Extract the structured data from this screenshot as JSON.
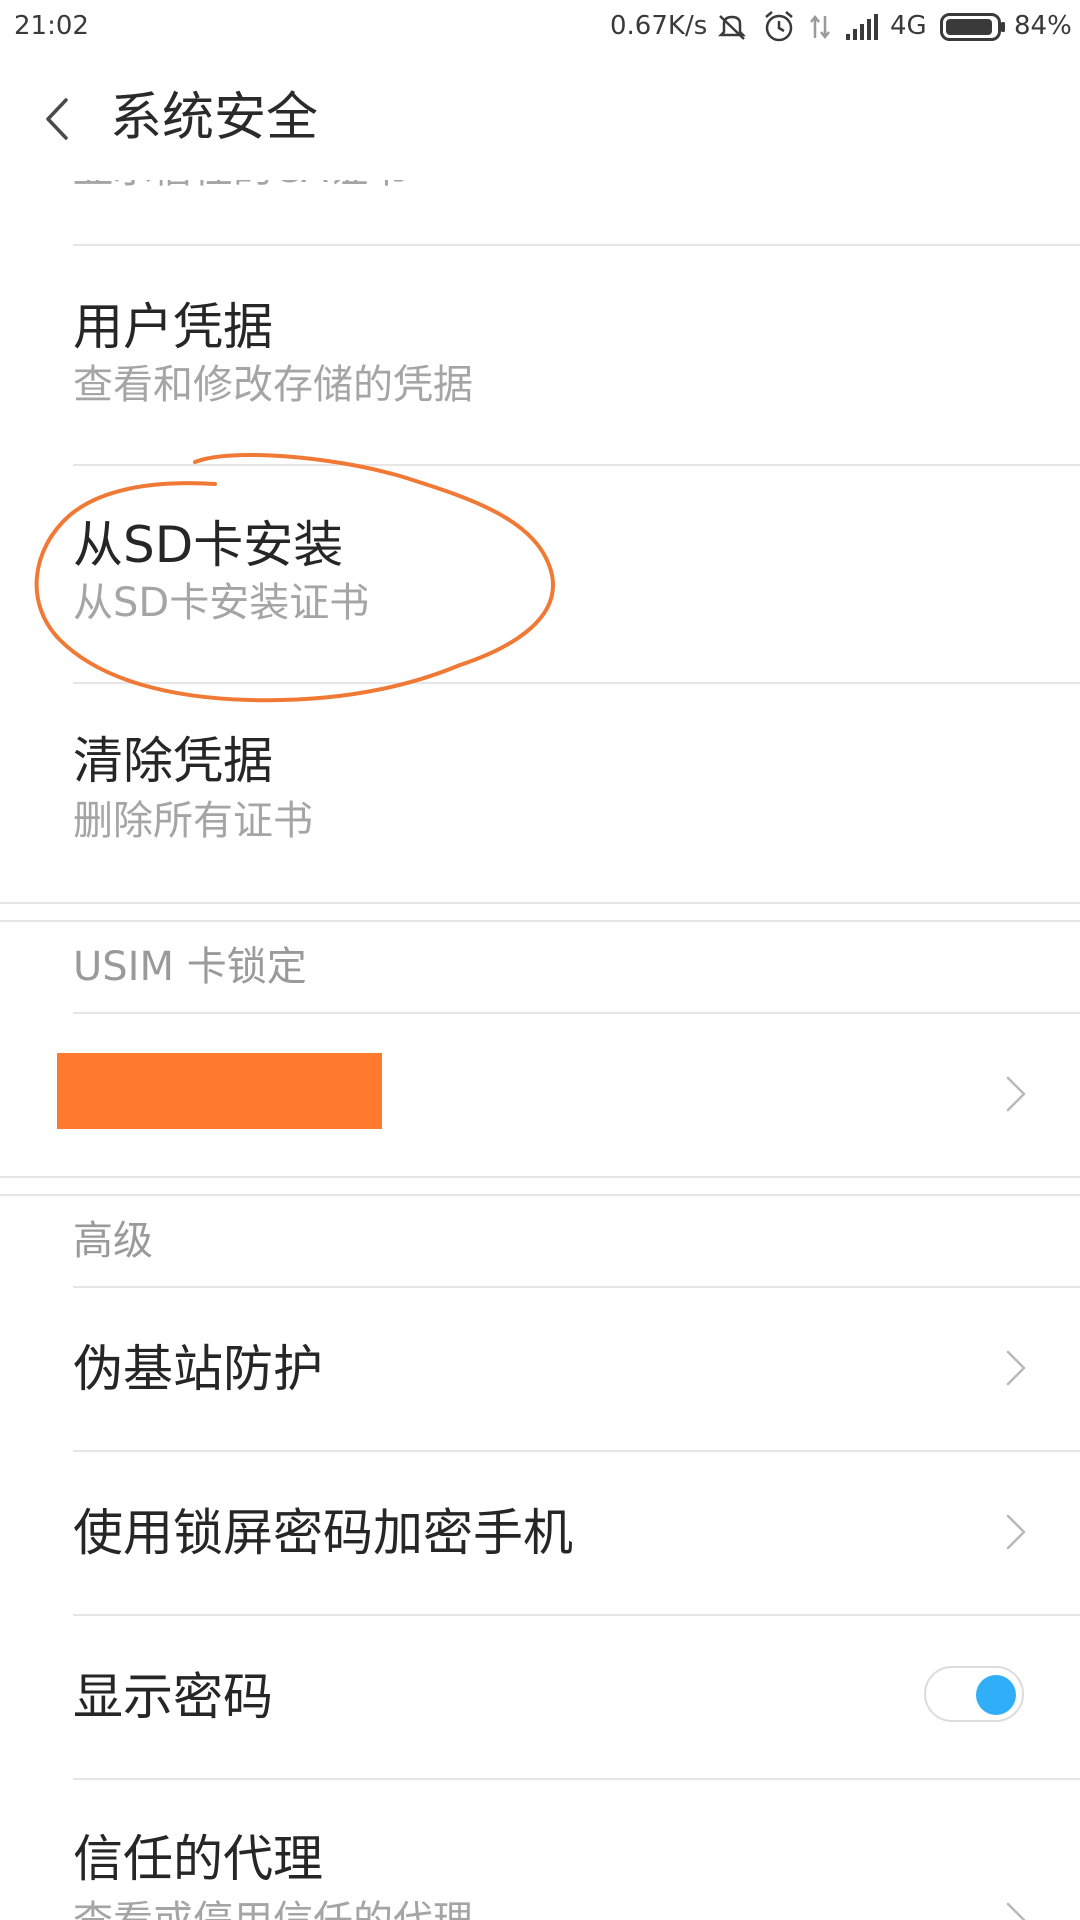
{
  "status_bar": {
    "time": "21:02",
    "net_speed": "0.67K/s",
    "network_type": "4G",
    "battery": "84%",
    "icons": [
      "mute-icon",
      "alarm-icon",
      "data-arrows-icon",
      "signal-icon",
      "battery-icon"
    ]
  },
  "header": {
    "title": "系统安全",
    "back_icon": "chevron-left-icon"
  },
  "partial_top_item": {
    "subtitle": "显示信任的CA证书"
  },
  "items": {
    "user_credentials": {
      "title": "用户凭据",
      "subtitle": "查看和修改存储的凭据"
    },
    "install_sd": {
      "title": "从SD卡安装",
      "subtitle": "从SD卡安装证书"
    },
    "clear_credentials": {
      "title": "清除凭据",
      "subtitle": "删除所有证书"
    }
  },
  "usim_section": {
    "label": "USIM 卡锁定",
    "redacted_item": {
      "redaction_color": "#ff7a2e"
    }
  },
  "advanced_section": {
    "label": "高级",
    "items": [
      {
        "title": "伪基站防护"
      },
      {
        "title": "使用锁屏密码加密手机"
      },
      {
        "title": "显示密码",
        "toggle_on": true
      },
      {
        "title": "信任的代理",
        "subtitle": "查看或停用信任的代理"
      }
    ]
  },
  "annotation_color": "#f07a35",
  "toggle_accent": "#30aef8"
}
